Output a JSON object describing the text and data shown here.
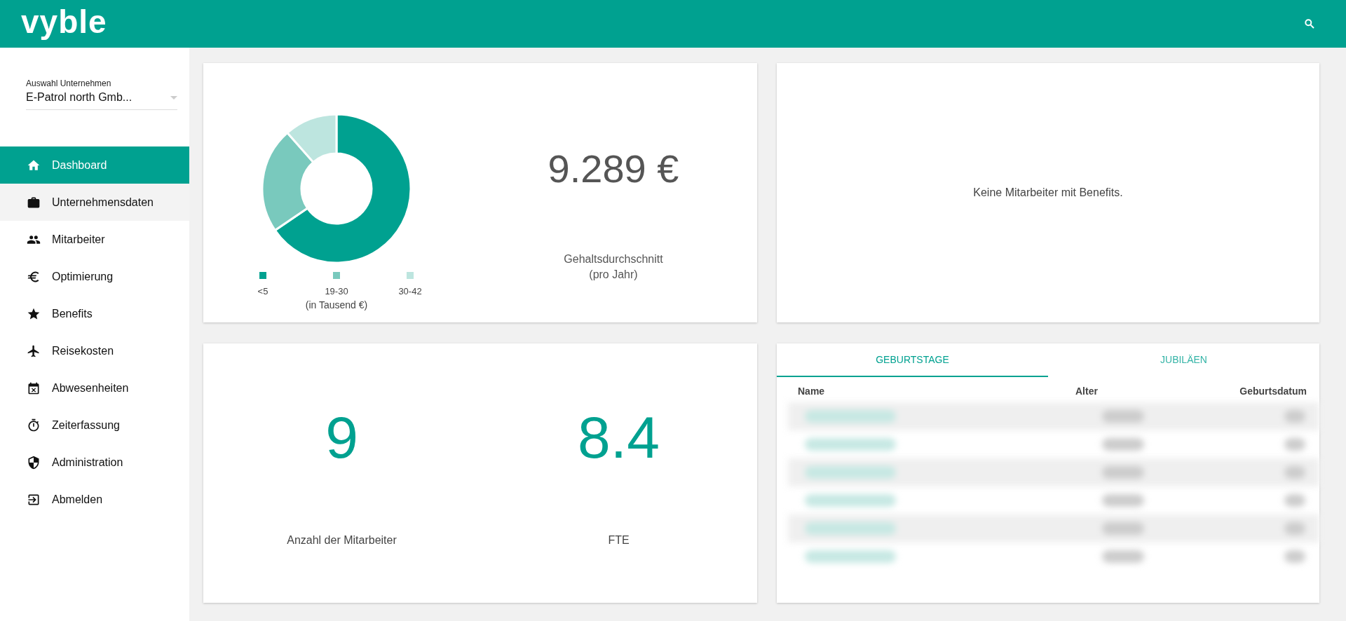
{
  "app": {
    "logo": "vyble"
  },
  "company_select": {
    "label": "Auswahl Unternehmen",
    "value": "E-Patrol north Gmb..."
  },
  "nav": [
    {
      "label": "Dashboard",
      "kind": "home",
      "selected": true,
      "hovered": false
    },
    {
      "label": "Unternehmensdaten",
      "kind": "briefcase",
      "selected": false,
      "hovered": true
    },
    {
      "label": "Mitarbeiter",
      "kind": "people",
      "selected": false,
      "hovered": false
    },
    {
      "label": "Optimierung",
      "kind": "euro",
      "selected": false,
      "hovered": false
    },
    {
      "label": "Benefits",
      "kind": "star",
      "selected": false,
      "hovered": false
    },
    {
      "label": "Reisekosten",
      "kind": "plane",
      "selected": false,
      "hovered": false
    },
    {
      "label": "Abwesenheiten",
      "kind": "calendar",
      "selected": false,
      "hovered": false
    },
    {
      "label": "Zeiterfassung",
      "kind": "stopwatch",
      "selected": false,
      "hovered": false
    },
    {
      "label": "Administration",
      "kind": "shield",
      "selected": false,
      "hovered": false
    },
    {
      "label": "Abmelden",
      "kind": "logout",
      "selected": false,
      "hovered": false
    }
  ],
  "salary_card": {
    "legend": [
      {
        "label": "<5",
        "color": "#00a190"
      },
      {
        "label": "19-30",
        "color": "#79c9bd"
      },
      {
        "label": "30-42",
        "color": "#bde5df"
      }
    ],
    "legend_unit": "(in Tausend €)",
    "average": "9.289 €",
    "caption": "Gehaltsdurchschnitt",
    "caption_note": "(pro Jahr)"
  },
  "benefits_card": {
    "message": "Keine Mitarbeiter mit Benefits."
  },
  "stats_card": {
    "stats": [
      {
        "value": "9",
        "label": "Anzahl der Mitarbeiter"
      },
      {
        "value": "8.4",
        "label": "FTE"
      }
    ]
  },
  "events_card": {
    "tabs": [
      {
        "label": "GEBURTSTAGE",
        "selected": true
      },
      {
        "label": "JUBILÄEN",
        "selected": false
      }
    ],
    "columns": [
      "Name",
      "Alter",
      "Geburtsdatum"
    ]
  }
}
